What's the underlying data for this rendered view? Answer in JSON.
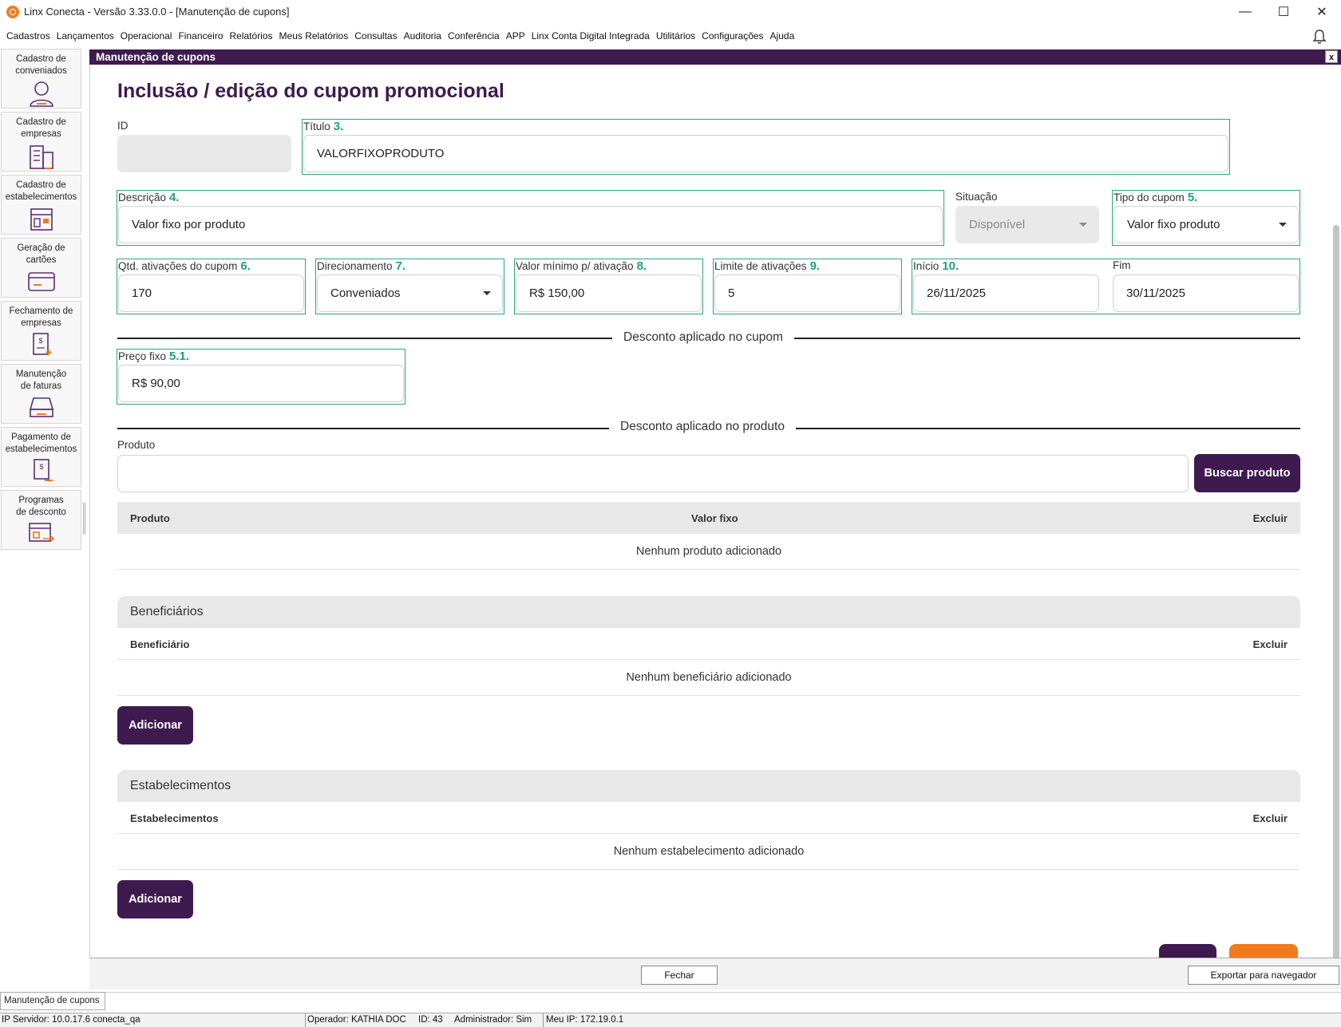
{
  "window": {
    "title": "Linx Conecta - Versão 3.33.0.0 - [Manutenção de cupons]",
    "minimize": "—",
    "maximize": "☐",
    "close": "✕"
  },
  "menu": [
    "Cadastros",
    "Lançamentos",
    "Operacional",
    "Financeiro",
    "Relatórios",
    "Meus Relatórios",
    "Consultas",
    "Auditoria",
    "Conferência",
    "APP",
    "Linx Conta Digital Integrada",
    "Utilitários",
    "Configurações",
    "Ajuda"
  ],
  "sidebar": [
    {
      "label1": "Cadastro de",
      "label2": "conveniados",
      "icon": "user-icon"
    },
    {
      "label1": "Cadastro de",
      "label2": "empresas",
      "icon": "building-icon"
    },
    {
      "label1": "Cadastro de",
      "label2": "estabelecimentos",
      "icon": "store-icon"
    },
    {
      "label1": "Geração de",
      "label2": "cartões",
      "icon": "card-icon"
    },
    {
      "label1": "Fechamento de",
      "label2": "empresas",
      "icon": "invoice-icon"
    },
    {
      "label1": "Manutenção",
      "label2": "de faturas",
      "icon": "tray-icon"
    },
    {
      "label1": "Pagamento de",
      "label2": "estabelecimentos",
      "icon": "payment-icon"
    },
    {
      "label1": "Programas",
      "label2": "de desconto",
      "icon": "discount-program-icon"
    }
  ],
  "child_window": {
    "title": "Manutenção de cupons",
    "close": "x"
  },
  "form": {
    "page_title": "Inclusão / edição do cupom promocional",
    "id": {
      "label": "ID",
      "value": ""
    },
    "titulo": {
      "label": "Título",
      "num": "3.",
      "value": "VALORFIXOPRODUTO"
    },
    "descricao": {
      "label": "Descrição",
      "num": "4.",
      "value": "Valor fixo por produto"
    },
    "situacao": {
      "label": "Situação",
      "value": "Disponível"
    },
    "tipo": {
      "label": "Tipo do cupom",
      "num": "5.",
      "value": "Valor fixo produto"
    },
    "qtd": {
      "label": "Qtd. ativações do cupom",
      "num": "6.",
      "value": "170"
    },
    "direcionamento": {
      "label": "Direcionamento",
      "num": "7.",
      "value": "Conveniados"
    },
    "valor_minimo": {
      "label": "Valor mínimo p/ ativação",
      "num": "8.",
      "value": "R$ 150,00"
    },
    "limite": {
      "label": "Limite de ativações",
      "num": "9.",
      "value": "5"
    },
    "inicio": {
      "label": "Início",
      "num": "10.",
      "value": "26/11/2025"
    },
    "fim": {
      "label": "Fim",
      "value": "30/11/2025"
    },
    "desconto_cupom": "Desconto aplicado no cupom",
    "preco_fixo": {
      "label": "Preço fixo",
      "num": "5.1.",
      "value": "R$ 90,00"
    },
    "desconto_produto": "Desconto aplicado no produto",
    "produto": {
      "label": "Produto",
      "value": ""
    },
    "buscar_produto": "Buscar produto",
    "produto_table": {
      "col_produto": "Produto",
      "col_valor": "Valor fixo",
      "col_excluir": "Excluir",
      "empty": "Nenhum produto adicionado"
    },
    "beneficiarios": {
      "title": "Beneficiários",
      "col": "Beneficiário",
      "col_excluir": "Excluir",
      "empty": "Nenhum beneficiário adicionado",
      "add": "Adicionar"
    },
    "estabelecimentos": {
      "title": "Estabelecimentos",
      "col": "Estabelecimentos",
      "col_excluir": "Excluir",
      "empty": "Nenhum estabelecimento adicionado",
      "add": "Adicionar"
    }
  },
  "bottom": {
    "fechar": "Fechar",
    "exportar": "Exportar para navegador",
    "tab": "Manutenção de cupons"
  },
  "status": {
    "servidor": "IP Servidor: 10.0.17.6 conecta_qa",
    "operador": "Operador: KATHIA DOC",
    "id": "ID: 43",
    "admin": "Administrador: Sim",
    "ip": "Meu IP: 172.19.0.1"
  },
  "colors": {
    "brand": "#3f1a4f",
    "accent": "#f27a1a",
    "highlight": "#2aa978"
  }
}
